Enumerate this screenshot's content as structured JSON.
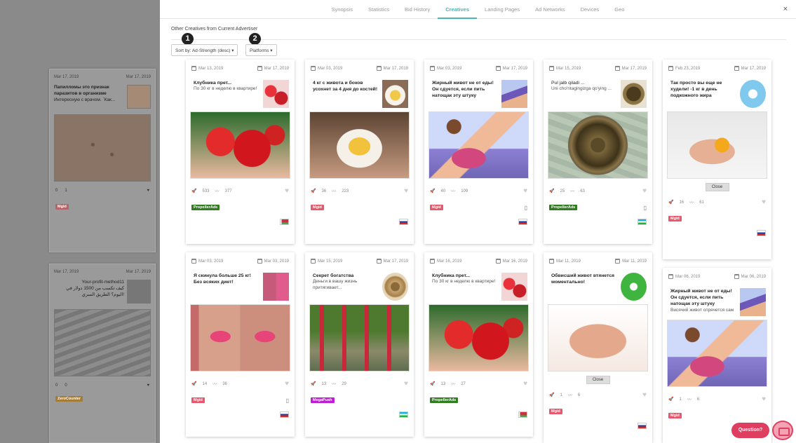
{
  "background": {
    "cards": [
      {
        "date_from": "Mar 17, 2019",
        "date_to": "Mar 17, 2019",
        "title": "Папилломы это признак паразитов в организме",
        "subtitle": "Интересную с врачом. `Как...",
        "clicks": "0",
        "trend": "1",
        "network": "Mgid"
      },
      {
        "date_from": "Mar 17, 2019",
        "date_to": "Mar 17, 2019",
        "title": "Your-profit-method11",
        "subtitle": "كيف تكسب من 1500 دولار في اليوم؟ الطريق السري!",
        "clicks": "0",
        "trend": "0",
        "network": "ZeroCounter"
      }
    ]
  },
  "modal": {
    "tabs": [
      "Synopsis",
      "Statistics",
      "Bid History",
      "Creatives",
      "Landing Pages",
      "Ad Networks",
      "Devices",
      "Geo"
    ],
    "active_tab": "Creatives",
    "close_icon": "×",
    "section_title": "Other Creatives from Current Advertiser",
    "sort_label": "Sort by: Ad-Strength (desc) ▾",
    "platforms_label": "Platforms ▾",
    "marker1": "1",
    "marker2": "2",
    "close_label": "Close",
    "question_label": "Question?",
    "cards": [
      {
        "date_from": "Mar 13, 2019",
        "date_to": "Mar 17, 2019",
        "title": "Клубника прет...",
        "subtitle": "По 30 кг в неделю в квартире!",
        "clicks": "533",
        "trend": "377",
        "network": "PropellerAds",
        "os": "apple",
        "flag": "by"
      },
      {
        "date_from": "Mar 03, 2019",
        "date_to": "Mar 17, 2019",
        "title": "4 кг с живота и боков усохнет за 4 дня до костей!",
        "subtitle": "",
        "clicks": "36",
        "trend": "223",
        "network": "Mgid",
        "os": "apple",
        "flag": "ru"
      },
      {
        "date_from": "Mar 03, 2019",
        "date_to": "Mar 17, 2019",
        "title": "Жирный живот не от еды! Он сдуется, если пить натощак эту штуку",
        "subtitle": "",
        "clicks": "40",
        "trend": "109",
        "network": "Mgid",
        "os": "mobile",
        "flag": "ru"
      },
      {
        "date_from": "Mar 15, 2019",
        "date_to": "Mar 17, 2019",
        "title": "Pul jalb qiladi ...",
        "subtitle": "Uni cho'ntagingizga qo'ying ...",
        "clicks": "25",
        "trend": "63",
        "network": "PropellerAds",
        "os": "mobile",
        "flag": "uz"
      },
      {
        "date_from": "Feb 23, 2019",
        "date_to": "Mar 17, 2019",
        "title": "Так просто вы еще не худели! -1 кг в день подкожного жира",
        "subtitle": "",
        "clicks": "16",
        "trend": "61",
        "network": "Mgid",
        "os": "apple",
        "flag": "ru"
      },
      {
        "date_from": "Mar 03, 2019",
        "date_to": "Mar 03, 2019",
        "title": "Я скинула больше 25 кг! Без всяких диет!",
        "subtitle": "",
        "clicks": "14",
        "trend": "36",
        "network": "Mgid",
        "os": "mobile",
        "flag": "ru"
      },
      {
        "date_from": "Mar 15, 2019",
        "date_to": "Mar 17, 2019",
        "title": "Секрет богатства",
        "subtitle": "Деньги в вашу жизнь притягивает...",
        "clicks": "13",
        "trend": "29",
        "network": "MegaPush",
        "os": "",
        "flag": "uz"
      },
      {
        "date_from": "Mar 16, 2019",
        "date_to": "Mar 16, 2019",
        "title": "Клубника прет...",
        "subtitle": "По 30 кг в неделю в квартире!",
        "clicks": "13",
        "trend": "27",
        "network": "PropellerAds",
        "os": "",
        "flag": "by"
      },
      {
        "date_from": "Mar 11, 2019",
        "date_to": "Mar 11, 2019",
        "title": "Обвисший живот втянется моментально!",
        "subtitle": "",
        "clicks": "1",
        "trend": "6",
        "network": "Mgid",
        "os": "apple",
        "flag": "ru"
      },
      {
        "date_from": "Mar 06, 2019",
        "date_to": "Mar 06, 2019",
        "title": "Жирный живот не от еды! Он сдуется, если пить натощак эту штуку",
        "subtitle": "Висячий живот спрячется сам",
        "clicks": "1",
        "trend": "6",
        "network": "Mgid",
        "os": "apple",
        "flag": "ru"
      }
    ]
  },
  "colors": {
    "accent": "#4ab5b5",
    "mgid": "#e8576b",
    "propeller": "#2f7d1e",
    "megapush": "#c01bd6",
    "zerocounter": "#c58a2c",
    "question": "#e03e61"
  }
}
